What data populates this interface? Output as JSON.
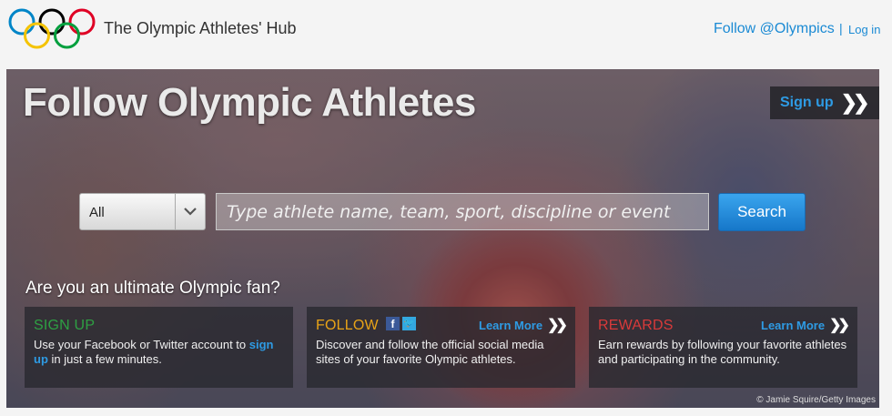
{
  "header": {
    "site_title": "The Olympic Athletes' Hub",
    "follow_link": "Follow @Olympics",
    "separator": "|",
    "login_link": "Log in"
  },
  "hero": {
    "title": "Follow Olympic Athletes",
    "signup_button": "Sign up",
    "credit": "© Jamie Squire/Getty Images"
  },
  "search": {
    "filter_selected": "All",
    "placeholder": "Type athlete name, team, sport, discipline or event",
    "button_label": "Search"
  },
  "fan": {
    "question": "Are you an ultimate Olympic fan?"
  },
  "cards": {
    "signup": {
      "title": "SIGN UP",
      "title_color": "#2ea043",
      "body_before": "Use your Facebook or Twitter account to ",
      "body_link": "sign up",
      "body_after": " in just a few minutes."
    },
    "follow": {
      "title": "FOLLOW",
      "title_color": "#e8a317",
      "link": "Learn More",
      "body": "Discover and follow the official social media sites of your favorite Olympic athletes."
    },
    "rewards": {
      "title": "REWARDS",
      "title_color": "#d93a3a",
      "link": "Learn More",
      "body": "Earn rewards by following your favorite athletes and participating in the community."
    }
  },
  "colors": {
    "link_blue": "#1a8ad4",
    "ring_blue": "#0085c7",
    "ring_yellow": "#f4c300",
    "ring_black": "#000000",
    "ring_green": "#009f3d",
    "ring_red": "#df0024"
  }
}
